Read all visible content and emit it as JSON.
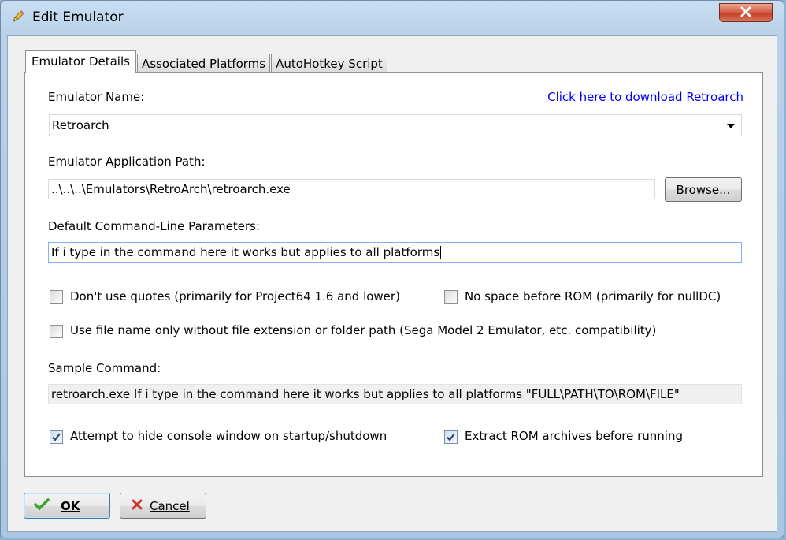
{
  "window": {
    "title": "Edit Emulator",
    "icon": "pencil-icon",
    "close_icon": "close-icon"
  },
  "tabs": [
    {
      "label": "Emulator Details",
      "active": true
    },
    {
      "label": "Associated Platforms",
      "active": false
    },
    {
      "label": "AutoHotkey Script",
      "active": false
    }
  ],
  "form": {
    "emulator_name_label": "Emulator Name:",
    "download_link": "Click here to download Retroarch",
    "emulator_name_value": "Retroarch",
    "app_path_label": "Emulator Application Path:",
    "app_path_value": "..\\..\\..\\Emulators\\RetroArch\\retroarch.exe",
    "browse_label": "Browse...",
    "params_label": "Default Command-Line Parameters:",
    "params_value": "If i type in the command here it works but applies to all platforms",
    "dont_use_quotes": {
      "label": "Don't use quotes (primarily for Project64 1.6 and lower)",
      "checked": false
    },
    "no_space": {
      "label": "No space before ROM (primarily for nullDC)",
      "checked": false
    },
    "file_name_only": {
      "label": "Use file name only without file extension or folder path (Sega Model 2 Emulator, etc. compatibility)",
      "checked": false
    },
    "sample_label": "Sample Command:",
    "sample_value": "retroarch.exe If i type in the command here it works but applies to all platforms \"FULL\\PATH\\TO\\ROM\\FILE\"",
    "hide_console": {
      "label": "Attempt to hide console window on startup/shutdown",
      "checked": true
    },
    "extract_rom": {
      "label": "Extract ROM archives before running",
      "checked": true
    }
  },
  "buttons": {
    "ok_label": "OK",
    "ok_icon": "checkmark-icon",
    "cancel_label": "Cancel",
    "cancel_icon": "x-icon"
  },
  "colors": {
    "link": "#0000ee",
    "focus_border": "#7eb4ea",
    "close_button": "#c23b22"
  }
}
